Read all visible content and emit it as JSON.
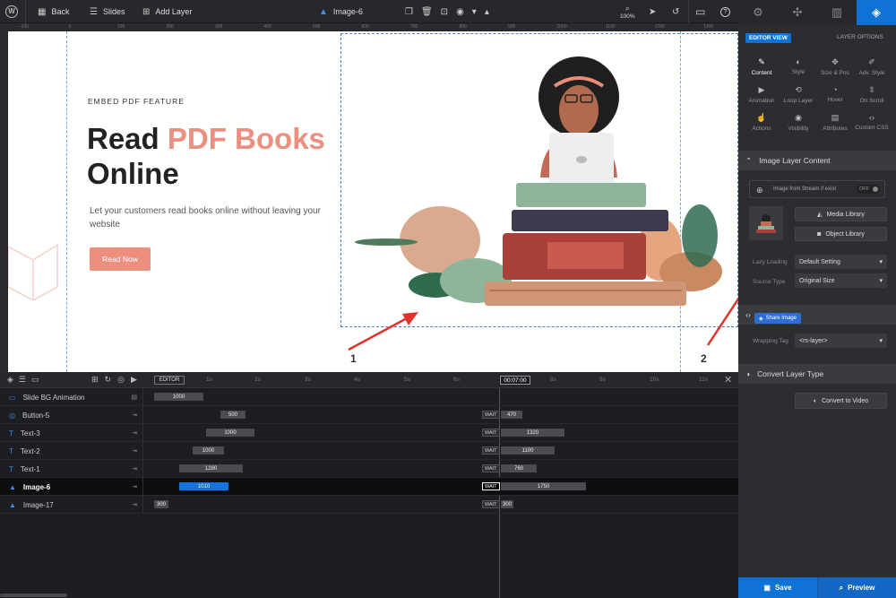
{
  "topbar": {
    "back": "Back",
    "slides": "Slides",
    "add_layer": "Add Layer",
    "layer_name": "Image-6",
    "zoom": "100%"
  },
  "slide": {
    "eyebrow": "EMBED PDF FEATURE",
    "title_part1": "Read ",
    "title_highlight": "PDF Books",
    "title_line2": "Online",
    "body": "Let your customers read books online without leaving your website",
    "cta": "Read Now",
    "annotation_1": "1",
    "annotation_2": "2",
    "colors": {
      "accent": "#ec8f7f",
      "heading": "#222222"
    }
  },
  "ruler_ticks": [
    "-100",
    "0",
    "100",
    "200",
    "300",
    "400",
    "500",
    "600",
    "700",
    "800",
    "900",
    "1000",
    "1100",
    "1200",
    "1300",
    "1400",
    "1500"
  ],
  "panel": {
    "editor_view": "EDITOR VIEW",
    "layer_options": "LAYER OPTIONS",
    "grid": [
      {
        "label": "Content",
        "icon": "pen-icon",
        "glyph": "✎"
      },
      {
        "label": "Style",
        "icon": "palette-icon",
        "glyph": "◐"
      },
      {
        "label": "Size & Pos",
        "icon": "move-icon",
        "glyph": "✥"
      },
      {
        "label": "Adv. Style",
        "icon": "brush-icon",
        "glyph": "✐"
      },
      {
        "label": "Animation",
        "icon": "film-icon",
        "glyph": "▶"
      },
      {
        "label": "Loop Layer",
        "icon": "loop-icon",
        "glyph": "⟲"
      },
      {
        "label": "Hover",
        "icon": "mouse-icon",
        "glyph": "◔"
      },
      {
        "label": "On Scroll",
        "icon": "scroll-icon",
        "glyph": "⇳"
      },
      {
        "label": "Actions",
        "icon": "hand-icon",
        "glyph": "☝"
      },
      {
        "label": "Visibility",
        "icon": "eye-icon",
        "glyph": "◉"
      },
      {
        "label": "Attributes",
        "icon": "doc-icon",
        "glyph": "▤"
      },
      {
        "label": "Custom CSS",
        "icon": "code-icon",
        "glyph": "‹›"
      }
    ],
    "section_image_content": "Image Layer Content",
    "stream_label": "Image from Stream if exist",
    "stream_toggle": "OFF",
    "media_library": "Media Library",
    "object_library": "Object Library",
    "lazy_loading_label": "Lazy Loading",
    "lazy_loading_value": "Default Setting",
    "source_type_label": "Source Type",
    "source_type_value": "Original Size",
    "share_image": "Share Image",
    "wrapping_tag_label": "Wrapping Tag",
    "wrapping_tag_value": "<rs-layer>",
    "convert_section": "Convert Layer Type",
    "convert_button": "Convert to Video",
    "save": "Save",
    "preview": "Preview"
  },
  "timeline": {
    "editor_tag": "EDITOR",
    "current_time": "00:07:00",
    "ticks": [
      "1s",
      "2s",
      "3s",
      "4s",
      "5s",
      "6s",
      "8s",
      "9s",
      "10s",
      "11s"
    ],
    "wait": "WAIT",
    "rows": [
      {
        "name": "Slide BG Animation",
        "icon": "slide-icon",
        "glyph": "▭",
        "in": "1000",
        "out": ""
      },
      {
        "name": "Button-5",
        "icon": "button-icon",
        "glyph": "◎",
        "in": "500",
        "out": "470"
      },
      {
        "name": "Text-3",
        "icon": "text-icon",
        "glyph": "T",
        "in": "1000",
        "out": "1320"
      },
      {
        "name": "Text-2",
        "icon": "text-icon",
        "glyph": "T",
        "in": "1000",
        "out": "1100"
      },
      {
        "name": "Text-1",
        "icon": "text-icon",
        "glyph": "T",
        "in": "1280",
        "out": "760"
      },
      {
        "name": "Image-6",
        "icon": "image-icon",
        "glyph": "▲",
        "in": "1010",
        "out": "1750"
      },
      {
        "name": "Image-17",
        "icon": "image-icon",
        "glyph": "▲",
        "in": "300",
        "out": "300"
      }
    ]
  }
}
